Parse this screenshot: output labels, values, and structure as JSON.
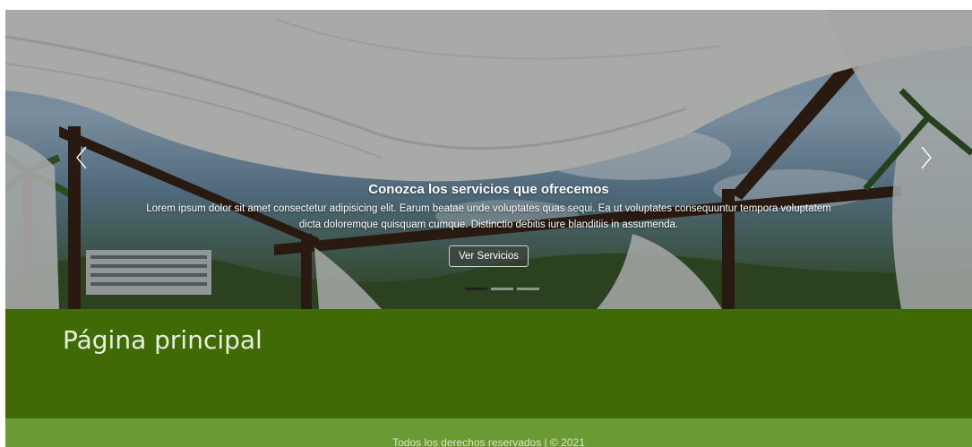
{
  "carousel": {
    "caption_title": "Conozca los servicios que ofrecemos",
    "caption_text": "Lorem ipsum dolor sit amet consectetur adipisicing elit. Earum beatae unde voluptates quas sequi. Ea ut voluptates consequuntur tempora voluptatem dicta doloremque quisquam cumque. Distinctio debitis iure blanditiis in assumenda.",
    "button_label": "Ver Servicios",
    "prev_icon": "chevron-left-icon",
    "next_icon": "chevron-right-icon",
    "slide_count": 3,
    "active_slide": 1
  },
  "main": {
    "page_title": "Página principal"
  },
  "footer": {
    "copyright": "Todos los derechos reservados | © 2021"
  },
  "colors": {
    "main_bg": "#3f6a06",
    "footer_bg": "#6a9a34",
    "indicator_active": "#222222"
  }
}
